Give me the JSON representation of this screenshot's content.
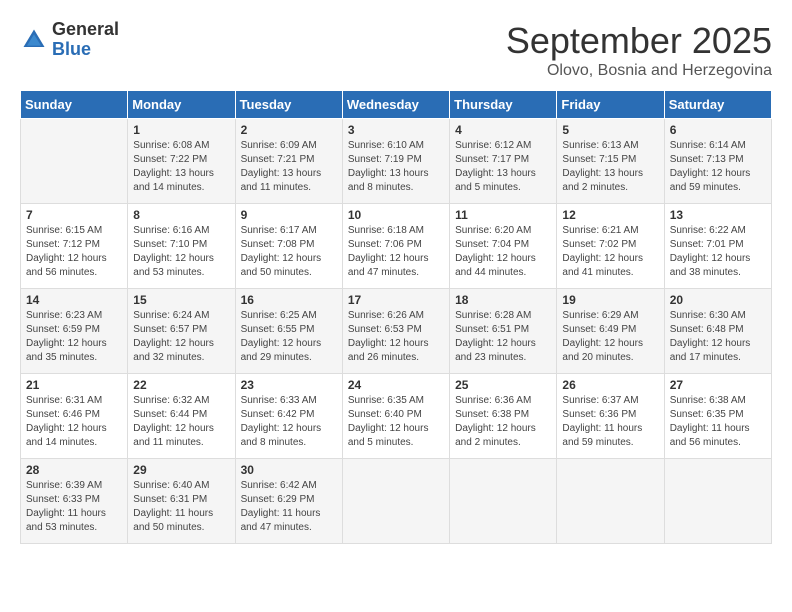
{
  "logo": {
    "general": "General",
    "blue": "Blue"
  },
  "header": {
    "month": "September 2025",
    "location": "Olovo, Bosnia and Herzegovina"
  },
  "days_of_week": [
    "Sunday",
    "Monday",
    "Tuesday",
    "Wednesday",
    "Thursday",
    "Friday",
    "Saturday"
  ],
  "weeks": [
    [
      {
        "day": "",
        "sunrise": "",
        "sunset": "",
        "daylight": ""
      },
      {
        "day": "1",
        "sunrise": "Sunrise: 6:08 AM",
        "sunset": "Sunset: 7:22 PM",
        "daylight": "Daylight: 13 hours and 14 minutes."
      },
      {
        "day": "2",
        "sunrise": "Sunrise: 6:09 AM",
        "sunset": "Sunset: 7:21 PM",
        "daylight": "Daylight: 13 hours and 11 minutes."
      },
      {
        "day": "3",
        "sunrise": "Sunrise: 6:10 AM",
        "sunset": "Sunset: 7:19 PM",
        "daylight": "Daylight: 13 hours and 8 minutes."
      },
      {
        "day": "4",
        "sunrise": "Sunrise: 6:12 AM",
        "sunset": "Sunset: 7:17 PM",
        "daylight": "Daylight: 13 hours and 5 minutes."
      },
      {
        "day": "5",
        "sunrise": "Sunrise: 6:13 AM",
        "sunset": "Sunset: 7:15 PM",
        "daylight": "Daylight: 13 hours and 2 minutes."
      },
      {
        "day": "6",
        "sunrise": "Sunrise: 6:14 AM",
        "sunset": "Sunset: 7:13 PM",
        "daylight": "Daylight: 12 hours and 59 minutes."
      }
    ],
    [
      {
        "day": "7",
        "sunrise": "Sunrise: 6:15 AM",
        "sunset": "Sunset: 7:12 PM",
        "daylight": "Daylight: 12 hours and 56 minutes."
      },
      {
        "day": "8",
        "sunrise": "Sunrise: 6:16 AM",
        "sunset": "Sunset: 7:10 PM",
        "daylight": "Daylight: 12 hours and 53 minutes."
      },
      {
        "day": "9",
        "sunrise": "Sunrise: 6:17 AM",
        "sunset": "Sunset: 7:08 PM",
        "daylight": "Daylight: 12 hours and 50 minutes."
      },
      {
        "day": "10",
        "sunrise": "Sunrise: 6:18 AM",
        "sunset": "Sunset: 7:06 PM",
        "daylight": "Daylight: 12 hours and 47 minutes."
      },
      {
        "day": "11",
        "sunrise": "Sunrise: 6:20 AM",
        "sunset": "Sunset: 7:04 PM",
        "daylight": "Daylight: 12 hours and 44 minutes."
      },
      {
        "day": "12",
        "sunrise": "Sunrise: 6:21 AM",
        "sunset": "Sunset: 7:02 PM",
        "daylight": "Daylight: 12 hours and 41 minutes."
      },
      {
        "day": "13",
        "sunrise": "Sunrise: 6:22 AM",
        "sunset": "Sunset: 7:01 PM",
        "daylight": "Daylight: 12 hours and 38 minutes."
      }
    ],
    [
      {
        "day": "14",
        "sunrise": "Sunrise: 6:23 AM",
        "sunset": "Sunset: 6:59 PM",
        "daylight": "Daylight: 12 hours and 35 minutes."
      },
      {
        "day": "15",
        "sunrise": "Sunrise: 6:24 AM",
        "sunset": "Sunset: 6:57 PM",
        "daylight": "Daylight: 12 hours and 32 minutes."
      },
      {
        "day": "16",
        "sunrise": "Sunrise: 6:25 AM",
        "sunset": "Sunset: 6:55 PM",
        "daylight": "Daylight: 12 hours and 29 minutes."
      },
      {
        "day": "17",
        "sunrise": "Sunrise: 6:26 AM",
        "sunset": "Sunset: 6:53 PM",
        "daylight": "Daylight: 12 hours and 26 minutes."
      },
      {
        "day": "18",
        "sunrise": "Sunrise: 6:28 AM",
        "sunset": "Sunset: 6:51 PM",
        "daylight": "Daylight: 12 hours and 23 minutes."
      },
      {
        "day": "19",
        "sunrise": "Sunrise: 6:29 AM",
        "sunset": "Sunset: 6:49 PM",
        "daylight": "Daylight: 12 hours and 20 minutes."
      },
      {
        "day": "20",
        "sunrise": "Sunrise: 6:30 AM",
        "sunset": "Sunset: 6:48 PM",
        "daylight": "Daylight: 12 hours and 17 minutes."
      }
    ],
    [
      {
        "day": "21",
        "sunrise": "Sunrise: 6:31 AM",
        "sunset": "Sunset: 6:46 PM",
        "daylight": "Daylight: 12 hours and 14 minutes."
      },
      {
        "day": "22",
        "sunrise": "Sunrise: 6:32 AM",
        "sunset": "Sunset: 6:44 PM",
        "daylight": "Daylight: 12 hours and 11 minutes."
      },
      {
        "day": "23",
        "sunrise": "Sunrise: 6:33 AM",
        "sunset": "Sunset: 6:42 PM",
        "daylight": "Daylight: 12 hours and 8 minutes."
      },
      {
        "day": "24",
        "sunrise": "Sunrise: 6:35 AM",
        "sunset": "Sunset: 6:40 PM",
        "daylight": "Daylight: 12 hours and 5 minutes."
      },
      {
        "day": "25",
        "sunrise": "Sunrise: 6:36 AM",
        "sunset": "Sunset: 6:38 PM",
        "daylight": "Daylight: 12 hours and 2 minutes."
      },
      {
        "day": "26",
        "sunrise": "Sunrise: 6:37 AM",
        "sunset": "Sunset: 6:36 PM",
        "daylight": "Daylight: 11 hours and 59 minutes."
      },
      {
        "day": "27",
        "sunrise": "Sunrise: 6:38 AM",
        "sunset": "Sunset: 6:35 PM",
        "daylight": "Daylight: 11 hours and 56 minutes."
      }
    ],
    [
      {
        "day": "28",
        "sunrise": "Sunrise: 6:39 AM",
        "sunset": "Sunset: 6:33 PM",
        "daylight": "Daylight: 11 hours and 53 minutes."
      },
      {
        "day": "29",
        "sunrise": "Sunrise: 6:40 AM",
        "sunset": "Sunset: 6:31 PM",
        "daylight": "Daylight: 11 hours and 50 minutes."
      },
      {
        "day": "30",
        "sunrise": "Sunrise: 6:42 AM",
        "sunset": "Sunset: 6:29 PM",
        "daylight": "Daylight: 11 hours and 47 minutes."
      },
      {
        "day": "",
        "sunrise": "",
        "sunset": "",
        "daylight": ""
      },
      {
        "day": "",
        "sunrise": "",
        "sunset": "",
        "daylight": ""
      },
      {
        "day": "",
        "sunrise": "",
        "sunset": "",
        "daylight": ""
      },
      {
        "day": "",
        "sunrise": "",
        "sunset": "",
        "daylight": ""
      }
    ]
  ]
}
